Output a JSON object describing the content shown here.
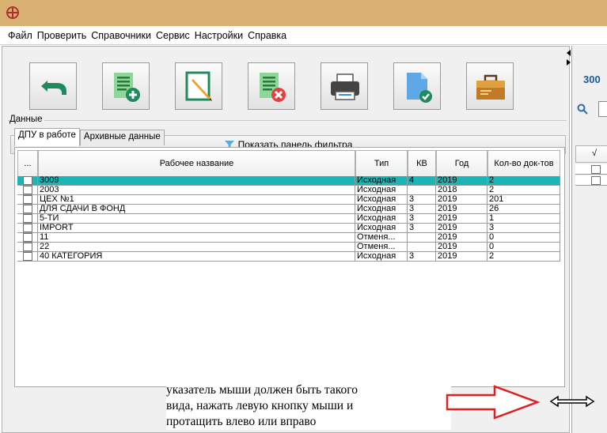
{
  "menu": [
    "Файл",
    "Проверить",
    "Справочники",
    "Сервис",
    "Настройки",
    "Справка"
  ],
  "toolbar": {
    "buttons": [
      "back",
      "add-document",
      "edit-document",
      "delete-document",
      "print",
      "approve-document",
      "archive-briefcase"
    ]
  },
  "filter": {
    "label": "Показать панель фильтра"
  },
  "group": {
    "label": "Данные"
  },
  "tabs": [
    {
      "label": "ДПУ в работе",
      "active": true
    },
    {
      "label": "Архивные данные",
      "active": false
    }
  ],
  "grid": {
    "columns": [
      "...",
      "Рабочее название",
      "Тип",
      "КВ",
      "Год",
      "Кол-во док-тов"
    ],
    "rows": [
      {
        "name": "3009",
        "type": "Исходная",
        "kv": "4",
        "year": "2019",
        "count": "2",
        "selected": true
      },
      {
        "name": "2003",
        "type": "Исходная",
        "kv": "",
        "year": "2018",
        "count": "2"
      },
      {
        "name": "ЦЕХ №1",
        "type": "Исходная",
        "kv": "3",
        "year": "2019",
        "count": "201"
      },
      {
        "name": "ДЛЯ СДАЧИ В ФОНД",
        "type": "Исходная",
        "kv": "3",
        "year": "2019",
        "count": "26"
      },
      {
        "name": "5-ТИ",
        "type": "Исходная",
        "kv": "3",
        "year": "2019",
        "count": "1"
      },
      {
        "name": "IMPORT",
        "type": "Исходная",
        "kv": "3",
        "year": "2019",
        "count": "3"
      },
      {
        "name": "11",
        "type": "Отменя...",
        "kv": "",
        "year": "2019",
        "count": "0"
      },
      {
        "name": "22",
        "type": "Отменя...",
        "kv": "",
        "year": "2019",
        "count": "0"
      },
      {
        "name": "40 КАТЕГОРИЯ",
        "type": "Исходная",
        "kv": "3",
        "year": "2019",
        "count": "2"
      }
    ]
  },
  "right_panel": {
    "title": "300",
    "check_header": "√"
  },
  "annotation": {
    "line1": "указатель мыши должен быть такого",
    "line2": "вида, нажать левую кнопку мыши и",
    "line3": "протащить влево или вправо"
  },
  "colors": {
    "titlebar": "#d7b072",
    "selected_row": "#1bb5b5",
    "arrow": "#e02020"
  }
}
